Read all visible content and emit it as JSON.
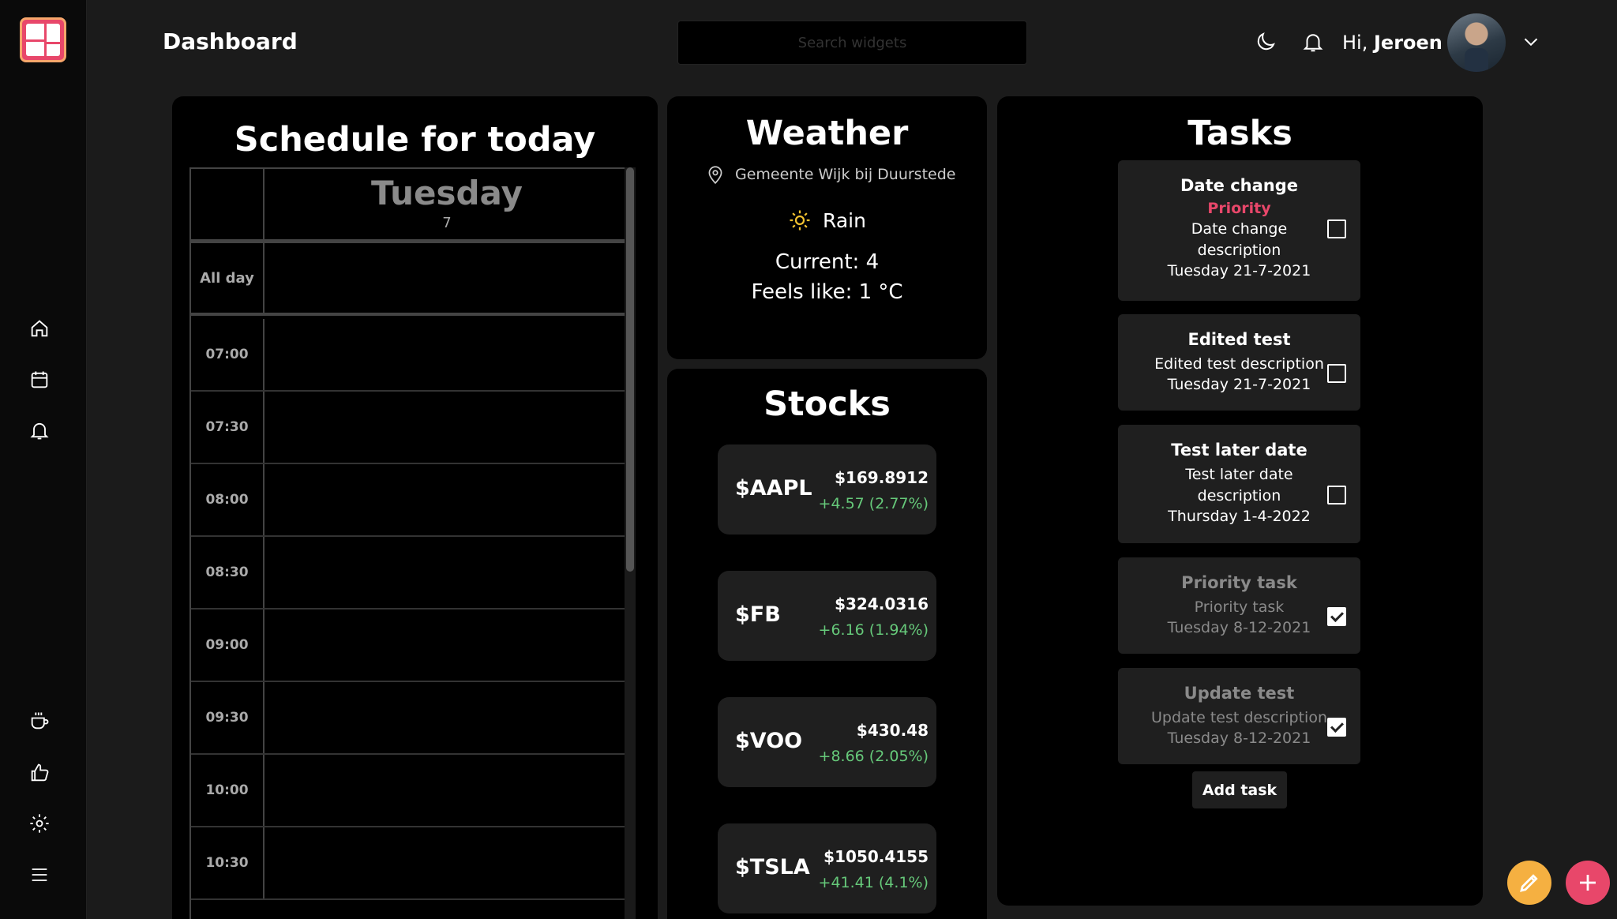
{
  "header": {
    "title": "Dashboard",
    "search_placeholder": "Search widgets",
    "greeting_prefix": "Hi,",
    "user_name": "Jeroen"
  },
  "colors": {
    "accent_pink": "#e8476a",
    "accent_orange": "#f7a66b",
    "fab_edit": "#f5b041",
    "positive": "#66c97a"
  },
  "sidebar": {
    "items": [
      {
        "icon": "home-icon"
      },
      {
        "icon": "calendar-icon"
      },
      {
        "icon": "bell-icon"
      },
      {
        "icon": "coffee-icon"
      },
      {
        "icon": "thumbs-up-icon"
      },
      {
        "icon": "gear-icon"
      },
      {
        "icon": "menu-icon"
      }
    ]
  },
  "schedule": {
    "title": "Schedule for today",
    "day_name": "Tuesday",
    "day_number": "7",
    "all_day_label": "All day",
    "slots": [
      "07:00",
      "07:30",
      "08:00",
      "08:30",
      "09:00",
      "09:30",
      "10:00",
      "10:30"
    ]
  },
  "weather": {
    "title": "Weather",
    "location": "Gemeente Wijk bij Duurstede",
    "condition": "Rain",
    "current": "Current: 4",
    "feels_like": "Feels like: 1 °C"
  },
  "stocks": {
    "title": "Stocks",
    "items": [
      {
        "symbol": "$AAPL",
        "price": "$169.8912",
        "change": "+4.57 (2.77%)"
      },
      {
        "symbol": "$FB",
        "price": "$324.0316",
        "change": "+6.16 (1.94%)"
      },
      {
        "symbol": "$VOO",
        "price": "$430.48",
        "change": "+8.66 (2.05%)"
      },
      {
        "symbol": "$TSLA",
        "price": "$1050.4155",
        "change": "+41.41 (4.1%)"
      }
    ]
  },
  "tasks": {
    "title": "Tasks",
    "items": [
      {
        "title": "Date change",
        "priority": "Priority",
        "description": "Date change description",
        "date": "Tuesday 21-7-2021",
        "done": false
      },
      {
        "title": "Edited test",
        "description": "Edited test description",
        "date": "Tuesday 21-7-2021",
        "done": false
      },
      {
        "title": "Test later date",
        "description": "Test later date description",
        "date": "Thursday 1-4-2022",
        "done": false
      },
      {
        "title": "Priority task",
        "description": "Priority task",
        "date": "Tuesday 8-12-2021",
        "done": true
      },
      {
        "title": "Update test",
        "description": "Update test description",
        "date": "Tuesday 8-12-2021",
        "done": true
      }
    ],
    "add_label": "Add task"
  }
}
